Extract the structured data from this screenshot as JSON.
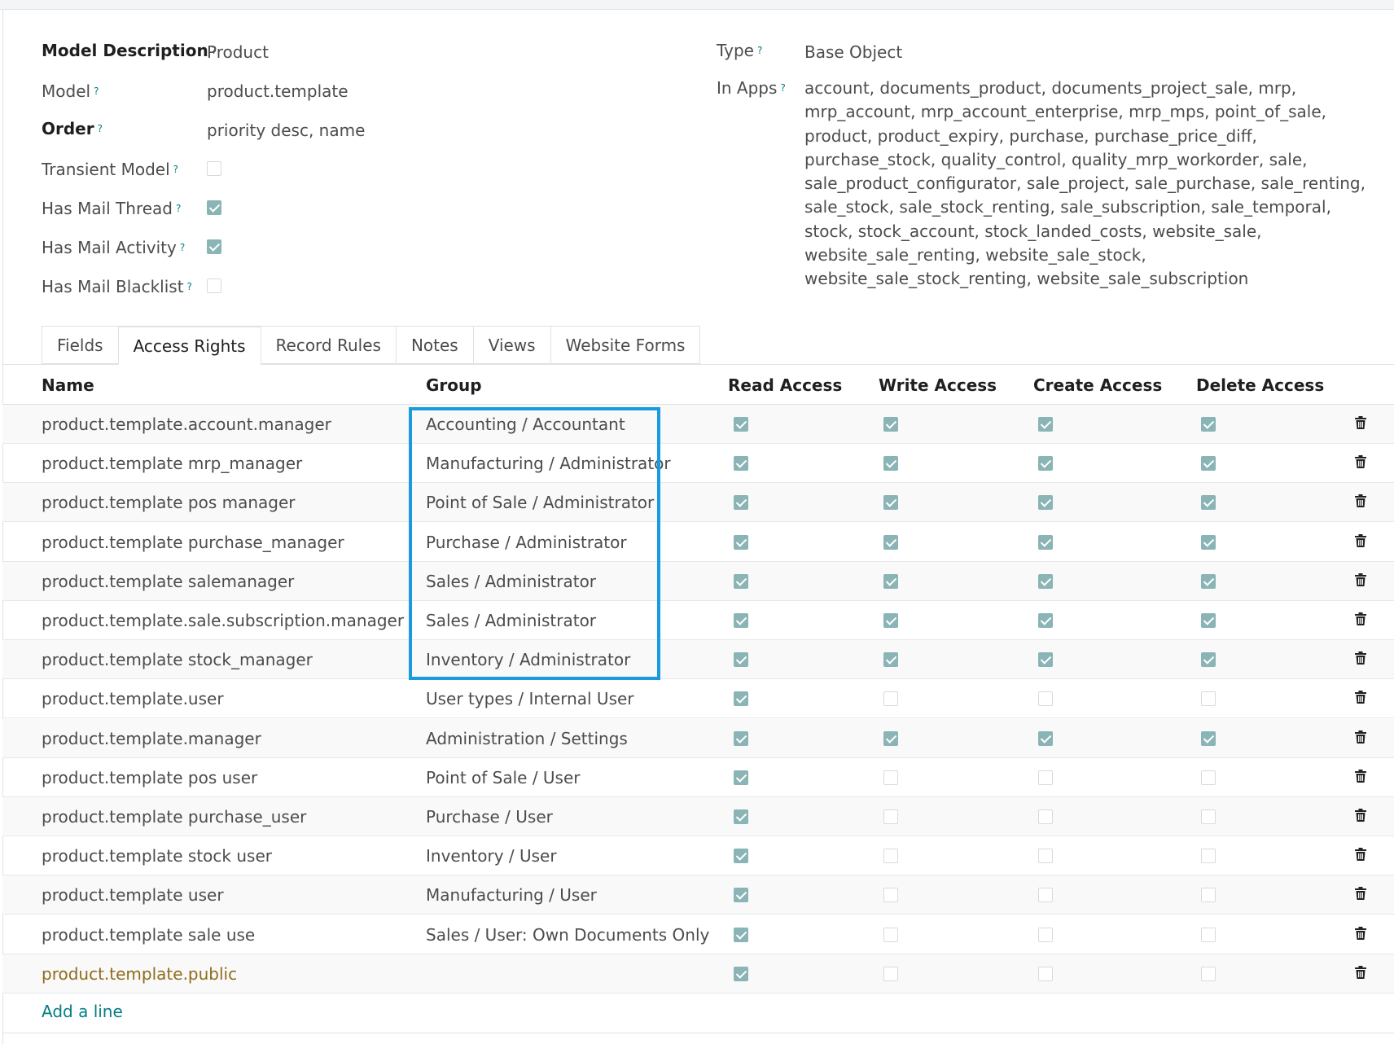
{
  "form": {
    "model_description": {
      "label": "Model Description",
      "value": "Product"
    },
    "model": {
      "label": "Model",
      "value": "product.template"
    },
    "order": {
      "label": "Order",
      "value": "priority desc, name"
    },
    "transient_model": {
      "label": "Transient Model",
      "checked": false
    },
    "has_mail_thread": {
      "label": "Has Mail Thread",
      "checked": true
    },
    "has_mail_activity": {
      "label": "Has Mail Activity",
      "checked": true
    },
    "has_mail_blacklist": {
      "label": "Has Mail Blacklist",
      "checked": false
    },
    "type": {
      "label": "Type",
      "value": "Base Object"
    },
    "in_apps": {
      "label": "In Apps",
      "value": "account, documents_product, documents_project_sale, mrp, mrp_account, mrp_account_enterprise, mrp_mps, point_of_sale, product, product_expiry, purchase, purchase_price_diff, purchase_stock, quality_control, quality_mrp_workorder, sale, sale_product_configurator, sale_project, sale_purchase, sale_renting, sale_stock, sale_stock_renting, sale_subscription, sale_temporal, stock, stock_account, stock_landed_costs, website_sale, website_sale_renting, website_sale_stock, website_sale_stock_renting, website_sale_subscription"
    },
    "help_mark": "?"
  },
  "tabs": [
    "Fields",
    "Access Rights",
    "Record Rules",
    "Notes",
    "Views",
    "Website Forms"
  ],
  "active_tab": "Access Rights",
  "table": {
    "headers": {
      "name": "Name",
      "group": "Group",
      "read": "Read Access",
      "write": "Write Access",
      "create": "Create Access",
      "delete": "Delete Access"
    },
    "rows": [
      {
        "name": "product.template.account.manager",
        "group": "Accounting / Accountant",
        "read": true,
        "write": true,
        "create": true,
        "delete": true
      },
      {
        "name": "product.template mrp_manager",
        "group": "Manufacturing / Administrator",
        "read": true,
        "write": true,
        "create": true,
        "delete": true
      },
      {
        "name": "product.template pos manager",
        "group": "Point of Sale / Administrator",
        "read": true,
        "write": true,
        "create": true,
        "delete": true
      },
      {
        "name": "product.template purchase_manager",
        "group": "Purchase / Administrator",
        "read": true,
        "write": true,
        "create": true,
        "delete": true
      },
      {
        "name": "product.template salemanager",
        "group": "Sales / Administrator",
        "read": true,
        "write": true,
        "create": true,
        "delete": true
      },
      {
        "name": "product.template.sale.subscription.manager",
        "group": "Sales / Administrator",
        "read": true,
        "write": true,
        "create": true,
        "delete": true
      },
      {
        "name": "product.template stock_manager",
        "group": "Inventory / Administrator",
        "read": true,
        "write": true,
        "create": true,
        "delete": true
      },
      {
        "name": "product.template.user",
        "group": "User types / Internal User",
        "read": true,
        "write": false,
        "create": false,
        "delete": false
      },
      {
        "name": "product.template.manager",
        "group": "Administration / Settings",
        "read": true,
        "write": true,
        "create": true,
        "delete": true
      },
      {
        "name": "product.template pos user",
        "group": "Point of Sale / User",
        "read": true,
        "write": false,
        "create": false,
        "delete": false
      },
      {
        "name": "product.template purchase_user",
        "group": "Purchase / User",
        "read": true,
        "write": false,
        "create": false,
        "delete": false
      },
      {
        "name": "product.template stock user",
        "group": "Inventory / User",
        "read": true,
        "write": false,
        "create": false,
        "delete": false
      },
      {
        "name": "product.template user",
        "group": "Manufacturing / User",
        "read": true,
        "write": false,
        "create": false,
        "delete": false
      },
      {
        "name": "product.template sale use",
        "group": "Sales / User: Own Documents Only",
        "read": true,
        "write": false,
        "create": false,
        "delete": false
      },
      {
        "name": "product.template.public",
        "group": "",
        "read": true,
        "write": false,
        "create": false,
        "delete": false,
        "muted": true
      }
    ],
    "add_line": "Add a line"
  },
  "colors": {
    "accent": "#017e84",
    "checkbox": "#8ab4b5",
    "highlight": "#1a9be0",
    "muted_link": "#8f6c1a"
  },
  "icons": {
    "row_delete": "trash-icon",
    "checkbox": "check-icon"
  }
}
